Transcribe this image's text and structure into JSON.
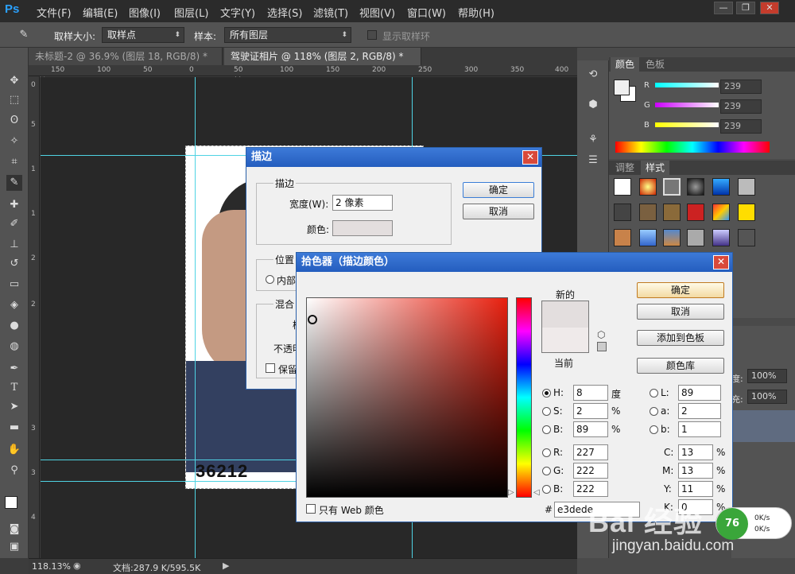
{
  "app": {
    "logo": "Ps",
    "menu": [
      "文件(F)",
      "编辑(E)",
      "图像(I)",
      "图层(L)",
      "文字(Y)",
      "选择(S)",
      "滤镜(T)",
      "视图(V)",
      "窗口(W)",
      "帮助(H)"
    ],
    "window_buttons": [
      "—",
      "❐",
      "✕"
    ]
  },
  "options": {
    "sample_size_label": "取样大小:",
    "sample_size_value": "取样点",
    "sample_label": "样本:",
    "sample_value": "所有图层",
    "show_ring_label": "显示取样环"
  },
  "tabs": [
    {
      "label": "未标题-2 @ 36.9% (图层 18, RGB/8) *",
      "close": "×",
      "active": false
    },
    {
      "label": "驾驶证相片 @ 118% (图层 2, RGB/8) *",
      "close": "×",
      "active": true
    }
  ],
  "ruler": {
    "top": [
      "150",
      "100",
      "50",
      "0",
      "50",
      "100",
      "150",
      "200",
      "250",
      "300",
      "350",
      "400"
    ],
    "left": [
      "0",
      "5",
      "1",
      "1",
      "2",
      "2",
      "3",
      "3",
      "4"
    ]
  },
  "canvas": {
    "photo_number": "36212"
  },
  "status": {
    "zoom": "118.13%",
    "doc": "文档:287.9 K/595.5K"
  },
  "color_panel": {
    "tabs": [
      "颜色",
      "色板"
    ],
    "r_label": "R",
    "g_label": "G",
    "b_label": "B",
    "r": "239",
    "g": "239",
    "b": "239"
  },
  "styles_panel": {
    "tabs": [
      "调整",
      "样式"
    ]
  },
  "layers_panel": {
    "opacity_label": "度:",
    "opacity_value": "100%",
    "fill_label": "充:",
    "fill_value": "100%"
  },
  "stroke_dialog": {
    "title": "描边",
    "group_stroke": "描边",
    "width_label": "宽度(W):",
    "width_value": "2 像素",
    "color_label": "颜色:",
    "ok": "确定",
    "cancel": "取消",
    "group_position": "位置",
    "inside_label": "内部",
    "group_blend": "混合",
    "blend_partial": "模",
    "opacity_partial": "不透明",
    "preserve_partial": "保留"
  },
  "picker_dialog": {
    "title": "拾色器（描边颜色）",
    "new_label": "新的",
    "current_label": "当前",
    "ok": "确定",
    "cancel": "取消",
    "add_swatch": "添加到色板",
    "libraries": "颜色库",
    "h_label": "H:",
    "h_value": "8",
    "h_unit": "度",
    "s_label": "S:",
    "s_value": "2",
    "s_unit": "%",
    "b_label": "B:",
    "b_value": "89",
    "b_unit": "%",
    "r_label": "R:",
    "r_value": "227",
    "g_label": "G:",
    "g_value": "222",
    "bb_label": "B:",
    "bb_value": "222",
    "l_label": "L:",
    "l_value": "89",
    "a_label": "a:",
    "a_value": "2",
    "b2_label": "b:",
    "b2_value": "1",
    "c_label": "C:",
    "c_value": "13",
    "c_unit": "%",
    "m_label": "M:",
    "m_value": "13",
    "m_unit": "%",
    "y_label": "Y:",
    "y_value": "11",
    "y_unit": "%",
    "k_label": "K:",
    "k_value": "0",
    "k_unit": "%",
    "web_only_label": "只有 Web 颜色",
    "hex_label": "#",
    "hex_value": "e3dede",
    "new_color": "#e3dede",
    "current_color": "#efeaea"
  },
  "watermark": {
    "logo": "Bai 经验",
    "url": "jingyan.baidu.com"
  },
  "net_widget": {
    "badge": "76",
    "up": "0K/s",
    "down": "0K/s"
  }
}
